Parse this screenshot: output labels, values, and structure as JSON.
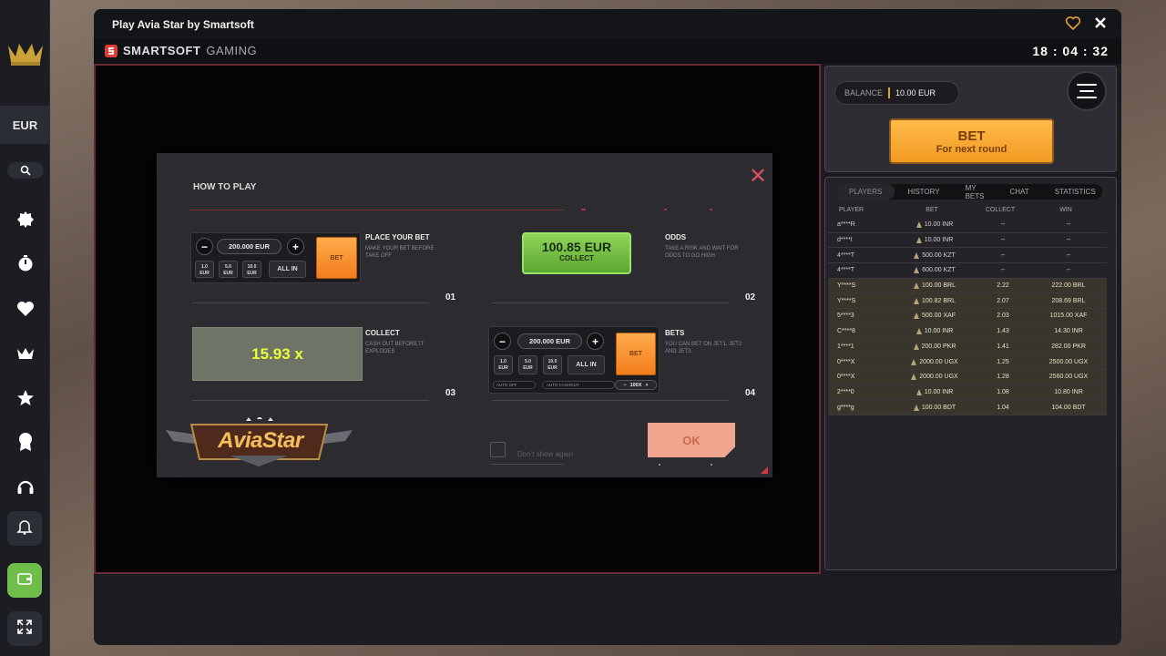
{
  "window": {
    "title": "Play Avia Star by Smartsoft"
  },
  "brand": {
    "name_strong": "SMARTSOFT",
    "name_light": "GAMING"
  },
  "clock": "18 : 04 : 32",
  "sidebar": {
    "currency": "EUR",
    "icons": [
      "crown-logo-icon",
      "search-icon",
      "new-badge-icon",
      "stopwatch-icon",
      "heart-icon",
      "crown-icon",
      "star-icon",
      "award-icon",
      "headset-icon",
      "bell-icon",
      "wallet-icon",
      "expand-icon"
    ]
  },
  "balance": {
    "label": "BALANCE",
    "value": "10.00 EUR"
  },
  "bet_button": {
    "label": "BET",
    "sub": "For next round"
  },
  "tabs": [
    "PLAYERS",
    "HISTORY",
    "MY BETS",
    "CHAT",
    "STATISTICS"
  ],
  "table": {
    "headers": [
      "PLAYER",
      "BET",
      "COLLECT",
      "WIN"
    ],
    "rows": [
      {
        "player": "a****R",
        "bet": "10.00 INR",
        "collect": "--",
        "win": "--",
        "won": false
      },
      {
        "player": "d****I",
        "bet": "10.00 INR",
        "collect": "--",
        "win": "--",
        "won": false
      },
      {
        "player": "4****T",
        "bet": "500.00 KZT",
        "collect": "--",
        "win": "--",
        "won": false
      },
      {
        "player": "4****T",
        "bet": "600.00 KZT",
        "collect": "--",
        "win": "--",
        "won": false
      },
      {
        "player": "Y****S",
        "bet": "100.00 BRL",
        "collect": "2.22",
        "win": "222.00 BRL",
        "won": true
      },
      {
        "player": "Y****S",
        "bet": "100.82 BRL",
        "collect": "2.07",
        "win": "208.69 BRL",
        "won": true
      },
      {
        "player": "5****3",
        "bet": "500.00 XAF",
        "collect": "2.03",
        "win": "1015.00 XAF",
        "won": true
      },
      {
        "player": "C****8",
        "bet": "10.00 INR",
        "collect": "1.43",
        "win": "14.30 INR",
        "won": true
      },
      {
        "player": "1****1",
        "bet": "200.00 PKR",
        "collect": "1.41",
        "win": "282.00 PKR",
        "won": true
      },
      {
        "player": "0****X",
        "bet": "2000.00 UGX",
        "collect": "1.25",
        "win": "2500.00 UGX",
        "won": true
      },
      {
        "player": "0****X",
        "bet": "2000.00 UGX",
        "collect": "1.28",
        "win": "2560.00 UGX",
        "won": true
      },
      {
        "player": "2****0",
        "bet": "10.00 INR",
        "collect": "1.08",
        "win": "10.80 INR",
        "won": true
      },
      {
        "player": "g****g",
        "bet": "100.00 BDT",
        "collect": "1.04",
        "win": "104.00 BDT",
        "won": true
      }
    ]
  },
  "modal": {
    "title": "HOW TO PLAY",
    "s1": {
      "title": "PLACE YOUR BET",
      "desc": "MAKE YOUR BET BEFORE TAKE OFF",
      "num": "01"
    },
    "s2": {
      "title": "ODDS",
      "desc": "TAKE A RISK AND WAIT FOR ODDS TO GO HIGH",
      "num": "02",
      "odds_value": "100.85 EUR",
      "odds_label": "COLLECT"
    },
    "s3": {
      "title": "COLLECT",
      "desc": "CASH OUT BEFORE IT EXPLODES",
      "num": "03",
      "mult": "15.93 x"
    },
    "s4": {
      "title": "BETS",
      "desc": "YOU CAN BET ON JET1, JET2 AND JET3.",
      "num": "04"
    },
    "bet_amount": "200.000 EUR",
    "bet_amount2": "200.000 EUR",
    "chips": [
      {
        "v": "1.0",
        "c": "EUR"
      },
      {
        "v": "5.0",
        "c": "EUR"
      },
      {
        "v": "10.0",
        "c": "EUR"
      }
    ],
    "all_in": "ALL IN",
    "bet": "BET",
    "auto_off": "AUTO OFF",
    "auto_cashout": "AUTO CASHOUT",
    "cashout_val": "100X",
    "dont_show": "Don't show again",
    "ok": "OK",
    "logo": "AviaStar"
  },
  "colors": {
    "accent": "#f19a22",
    "win_row": "#38352c",
    "odds_green": "#6fbe3d",
    "close_red": "#e0505a"
  }
}
